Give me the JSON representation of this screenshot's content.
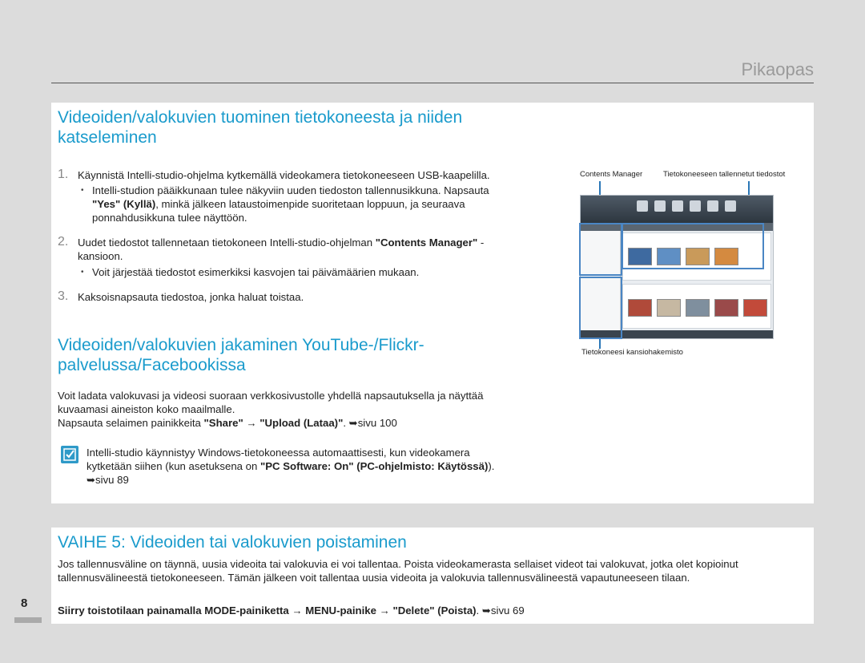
{
  "header": {
    "title": "Pikaopas"
  },
  "section1": {
    "title": "Videoiden/valokuvien tuominen tietokoneesta ja niiden katseleminen",
    "steps": [
      {
        "num": "1.",
        "text_a": "Käynnistä Intelli-studio-ohjelma kytkemällä videokamera tietokoneeseen USB-kaapelilla.",
        "bullet": {
          "t1": "Intelli-studion pääikkunaan tulee näkyviin uuden tiedoston tallennusikkuna. Napsauta ",
          "b1": "\"Yes\" (Kyllä)",
          "t2": ", minkä jälkeen lataustoimenpide suoritetaan loppuun, ja seuraava ponnahdusikkuna tulee näyttöön."
        }
      },
      {
        "num": "2.",
        "t1": "Uudet tiedostot tallennetaan tietokoneen Intelli-studio-ohjelman ",
        "b1": "\"Contents Manager\"",
        "t2": " -kansioon.",
        "bullet": "Voit järjestää tiedostot esimerkiksi kasvojen tai päivämäärien mukaan."
      },
      {
        "num": "3.",
        "text": "Kaksoisnapsauta tiedostoa, jonka haluat toistaa."
      }
    ]
  },
  "screenshot": {
    "label_contents_manager": "Contents Manager",
    "label_saved_files": "Tietokoneeseen tallennetut tiedostot",
    "label_folder_dir": "Tietokoneesi kansiohakemisto"
  },
  "section2": {
    "title": "Videoiden/valokuvien jakaminen YouTube-/Flickr-palvelussa/Facebookissa",
    "para": "Voit ladata valokuvasi ja videosi suoraan verkkosivustolle yhdellä napsautuksella ja näyttää kuvaamasi aineiston koko maailmalle.",
    "line_t1": "Napsauta selaimen painikkeita ",
    "line_b1": "\"Share\"",
    "line_arrow": " → ",
    "line_b2": "\"Upload (Lataa)\"",
    "line_t2": ". ➥sivu 100",
    "note_t1": "Intelli-studio käynnistyy Windows-tietokoneessa automaattisesti, kun videokamera kytketään siihen (kun asetuksena on ",
    "note_b1": "\"PC Software: On\" (PC-ohjelmisto: Käytössä)",
    "note_t2": "). ➥sivu 89"
  },
  "section3": {
    "title": "VAIHE 5: Videoiden tai valokuvien poistaminen",
    "para": "Jos tallennusväline on täynnä, uusia videoita tai valokuvia ei voi tallentaa. Poista videokamerasta sellaiset videot tai valokuvat, jotka olet kopioinut tallennusvälineestä tietokoneeseen. Tämän jälkeen voit tallentaa uusia videoita ja valokuvia tallennusvälineestä vapautuneeseen tilaan.",
    "instr_b1": "Siirry toistotilaan painamalla MODE-painiketta",
    "instr_a1": " → ",
    "instr_b2": "MENU-painike",
    "instr_a2": " → ",
    "instr_b3": "\"Delete\" (Poista)",
    "instr_t": ". ➥sivu 69"
  },
  "page_number": "8",
  "colors": {
    "accent": "#1a9bcc",
    "note_icon": "#2f9ac8"
  }
}
